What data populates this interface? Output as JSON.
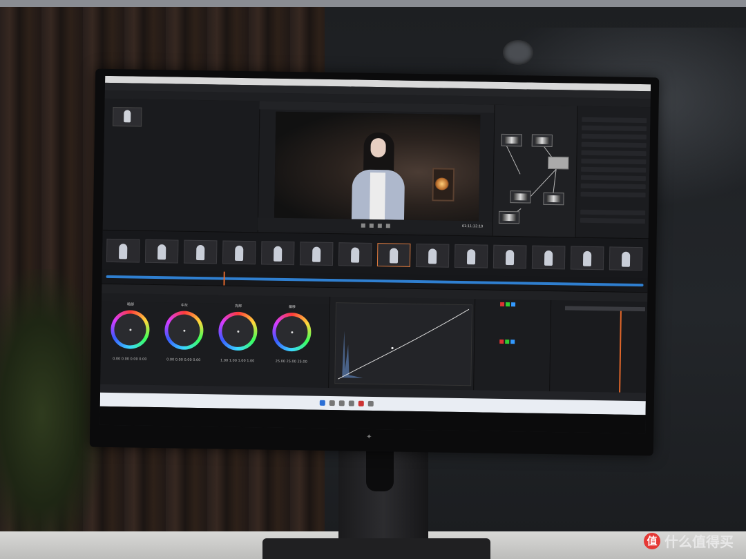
{
  "viewer": {
    "timecode": "01:11:32:10"
  },
  "timeline_clips": 14,
  "color_wheels": [
    {
      "label": "暗部",
      "values": "0.00  0.00  0.00  0.00"
    },
    {
      "label": "中灰",
      "values": "0.00  0.00  0.00  0.00"
    },
    {
      "label": "亮部",
      "values": "1.00  1.00  1.00  1.00"
    },
    {
      "label": "偏移",
      "values": "25.00  25.00  25.00"
    }
  ],
  "watermark": {
    "badge": "值",
    "text": "什么值得买"
  },
  "colors": {
    "accent": "#e07a3c",
    "timeline_wave": "#2f7fd0",
    "playhead": "#e0662a"
  }
}
